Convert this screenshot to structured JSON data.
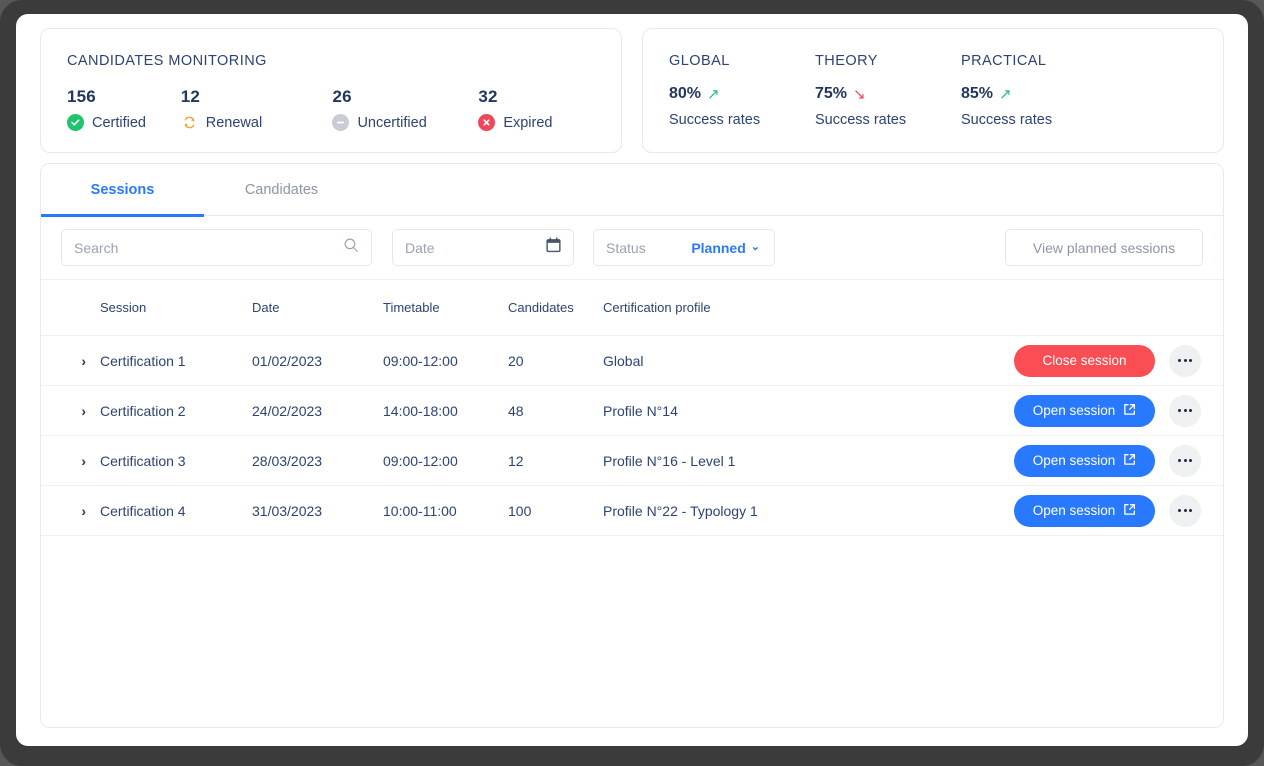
{
  "monitoring": {
    "title": "CANDIDATES MONITORING",
    "stats": [
      {
        "value": "156",
        "label": "Certified",
        "icon": "check-circle-icon",
        "color": "#1ec46e"
      },
      {
        "value": "12",
        "label": "Renewal",
        "icon": "refresh-icon",
        "color": "#f5a623"
      },
      {
        "value": "26",
        "label": "Uncertified",
        "icon": "minus-circle-icon",
        "color": "#c8ccd4"
      },
      {
        "value": "32",
        "label": "Expired",
        "icon": "x-circle-icon",
        "color": "#f1475a"
      }
    ]
  },
  "rates": [
    {
      "head": "GLOBAL",
      "value": "80%",
      "trend": "up",
      "arrow": "↗",
      "sub": "Success rates",
      "color": "#22c08a"
    },
    {
      "head": "THEORY",
      "value": "75%",
      "trend": "down",
      "arrow": "↘",
      "sub": "Success rates",
      "color": "#f1475a"
    },
    {
      "head": "PRACTICAL",
      "value": "85%",
      "trend": "up",
      "arrow": "↗",
      "sub": "Success rates",
      "color": "#22c08a"
    }
  ],
  "tabs": [
    {
      "label": "Sessions",
      "active": true
    },
    {
      "label": "Candidates",
      "active": false
    }
  ],
  "filters": {
    "search_placeholder": "Search",
    "search_value": "",
    "search_icon": "search-icon",
    "date_placeholder": "Date",
    "date_value": "",
    "date_icon": "calendar-icon",
    "status_label": "Status",
    "status_value": "Planned",
    "status_caret": "⌄",
    "view_button": "View planned sessions"
  },
  "table": {
    "columns": [
      "Session",
      "Date",
      "Timetable",
      "Candidates",
      "Certification profile"
    ],
    "rows": [
      {
        "expand": "›",
        "session": "Certification 1",
        "date": "01/02/2023",
        "timetable": "09:00-12:00",
        "candidates": "20",
        "profile": "Global",
        "action_label": "Close session",
        "action_style": "red",
        "action_icon": "",
        "menu_icon": "more-horizontal-icon"
      },
      {
        "expand": "›",
        "session": "Certification 2",
        "date": "24/02/2023",
        "timetable": "14:00-18:00",
        "candidates": "48",
        "profile": "Profile N°14",
        "action_label": "Open session",
        "action_style": "blue",
        "action_icon": "external-link-icon",
        "menu_icon": "more-horizontal-icon"
      },
      {
        "expand": "›",
        "session": "Certification 3",
        "date": "28/03/2023",
        "timetable": "09:00-12:00",
        "candidates": "12",
        "profile": "Profile N°16 - Level 1",
        "action_label": "Open session",
        "action_style": "blue",
        "action_icon": "external-link-icon",
        "menu_icon": "more-horizontal-icon"
      },
      {
        "expand": "›",
        "session": "Certification 4",
        "date": "31/03/2023",
        "timetable": "10:00-11:00",
        "candidates": "100",
        "profile": "Profile N°22 - Typology 1",
        "action_label": "Open session",
        "action_style": "blue",
        "action_icon": "external-link-icon",
        "menu_icon": "more-horizontal-icon"
      }
    ]
  },
  "colors": {
    "primary_blue": "#2979ff",
    "danger_red": "#fb4d54",
    "text_navy": "#2d4373",
    "muted": "#8d95a6",
    "success_green": "#1ec46e"
  }
}
